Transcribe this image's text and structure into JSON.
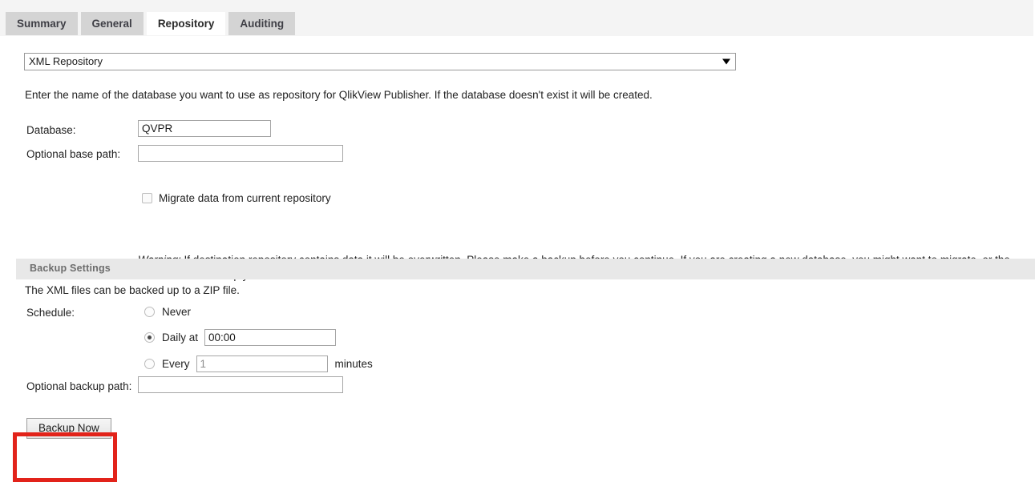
{
  "tabs": [
    {
      "label": "Summary",
      "active": false
    },
    {
      "label": "General",
      "active": false
    },
    {
      "label": "Repository",
      "active": true
    },
    {
      "label": "Auditing",
      "active": false
    }
  ],
  "repository": {
    "select_value": "XML Repository",
    "dropdown_icon": "chevron-down-icon",
    "description": "Enter the name of the database you want to use as repository for QlikView Publisher. If the database doesn't exist it will be created.",
    "database_label": "Database:",
    "database_value": "QVPR",
    "base_path_label": "Optional base path:",
    "base_path_value": "",
    "migrate_label": "Migrate data from current repository",
    "migrate_checked": false,
    "warning_prefix": "Warning:",
    "warning_text": " If destination repository contains data it will be overwritten. Please make a backup before you continue. If you are creating a new database, you might want to migrate, or the database will be empty from start."
  },
  "backup": {
    "section_title": "Backup Settings",
    "note": "The XML files can be backed up to a ZIP file.",
    "schedule_label": "Schedule:",
    "options": [
      {
        "label": "Never",
        "selected": false
      },
      {
        "label": "Daily at",
        "selected": true
      },
      {
        "label": "Every",
        "selected": false
      }
    ],
    "daily_time_value": "00:00",
    "every_value": "1",
    "every_unit": "minutes",
    "backup_path_label": "Optional backup path:",
    "backup_path_value": "",
    "backup_now_label": "Backup Now"
  },
  "annotation": {
    "target": "backup-now-button",
    "color": "#e2231a"
  }
}
